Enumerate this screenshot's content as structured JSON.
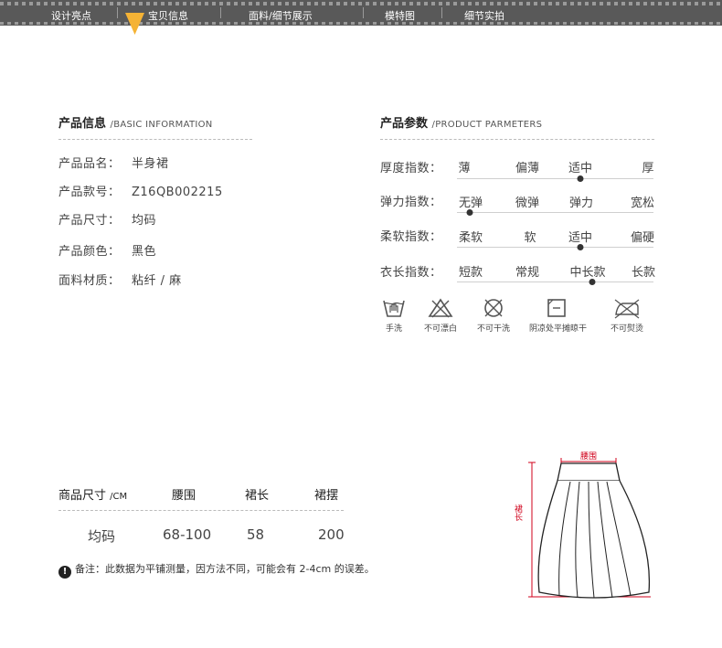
{
  "nav": {
    "items": [
      {
        "label": "设计亮点"
      },
      {
        "label": "宝贝信息"
      },
      {
        "label": "面料/细节展示"
      },
      {
        "label": "模特图"
      },
      {
        "label": "细节实拍"
      }
    ],
    "active_color": "#f5b335"
  },
  "product_info": {
    "title": "产品信息",
    "subtitle": "/BASIC INFORMATION",
    "rows": [
      {
        "label": "产品品名：",
        "value": "半身裙"
      },
      {
        "label": "产品款号：",
        "value": "Z16QB002215"
      },
      {
        "label": "产品尺寸：",
        "value": "均码"
      },
      {
        "label": "产品颜色：",
        "value": "黑色"
      },
      {
        "label": "面料材质：",
        "value": "粘纤 / 麻"
      }
    ]
  },
  "product_params": {
    "title": "产品参数",
    "subtitle": "/PRODUCT PARMETERS",
    "rows": [
      {
        "label": "厚度指数：",
        "options": [
          "薄",
          "偏薄",
          "适中",
          "厚"
        ],
        "selected_index": 2
      },
      {
        "label": "弹力指数：",
        "options": [
          "无弹",
          "微弹",
          "弹力",
          "宽松"
        ],
        "selected_index": 0
      },
      {
        "label": "柔软指数：",
        "options": [
          "柔软",
          "软",
          "适中",
          "偏硬"
        ],
        "selected_index": 2
      },
      {
        "label": "衣长指数：",
        "options": [
          "短款",
          "常规",
          "中长款",
          "长款"
        ],
        "selected_index": 2
      }
    ]
  },
  "care": [
    {
      "icon": "hand-wash-icon",
      "label": "手洗"
    },
    {
      "icon": "no-bleach-icon",
      "label": "不可漂白"
    },
    {
      "icon": "no-tumble-dry-icon",
      "label": "不可干洗"
    },
    {
      "icon": "dry-flat-shade-icon",
      "label": "阴凉处平摊晾干"
    },
    {
      "icon": "no-iron-icon",
      "label": "不可熨烫"
    }
  ],
  "size_table": {
    "header_label": "商品尺寸",
    "header_unit": "/CM",
    "columns": [
      "腰围",
      "裙长",
      "裙摆"
    ],
    "row": {
      "size": "均码",
      "values": [
        "68-100",
        "58",
        "200"
      ]
    }
  },
  "note": {
    "icon": "exclamation-icon",
    "text": "备注：此数据为平铺测量，因方法不同，可能会有 2-4cm 的误差。"
  },
  "diagram": {
    "waist_label": "腰围",
    "length_label": "裙长",
    "accent_color": "#d0021b"
  }
}
